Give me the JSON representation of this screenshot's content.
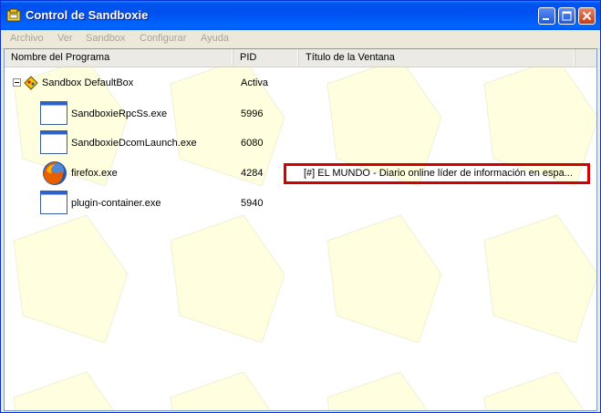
{
  "window": {
    "title": "Control de Sandboxie"
  },
  "menu": [
    "Archivo",
    "Ver",
    "Sandbox",
    "Configurar",
    "Ayuda"
  ],
  "columns": {
    "name": "Nombre del Programa",
    "pid": "PID",
    "title": "Título de la Ventana"
  },
  "sandbox": {
    "name": "Sandbox DefaultBox",
    "status": "Activa"
  },
  "processes": [
    {
      "name": "SandboxieRpcSs.exe",
      "pid": "5996",
      "window_title": "",
      "icon": "window-icon"
    },
    {
      "name": "SandboxieDcomLaunch.exe",
      "pid": "6080",
      "window_title": "",
      "icon": "window-icon"
    },
    {
      "name": "firefox.exe",
      "pid": "4284",
      "window_title": "[#] EL MUNDO - Diario online líder de información en espa...",
      "icon": "firefox-icon"
    },
    {
      "name": "plugin-container.exe",
      "pid": "5940",
      "window_title": "",
      "icon": "window-icon"
    }
  ],
  "colors": {
    "titlebar": "#0054E3",
    "highlight": "#D40000",
    "pattern": "#FFFFE0"
  }
}
